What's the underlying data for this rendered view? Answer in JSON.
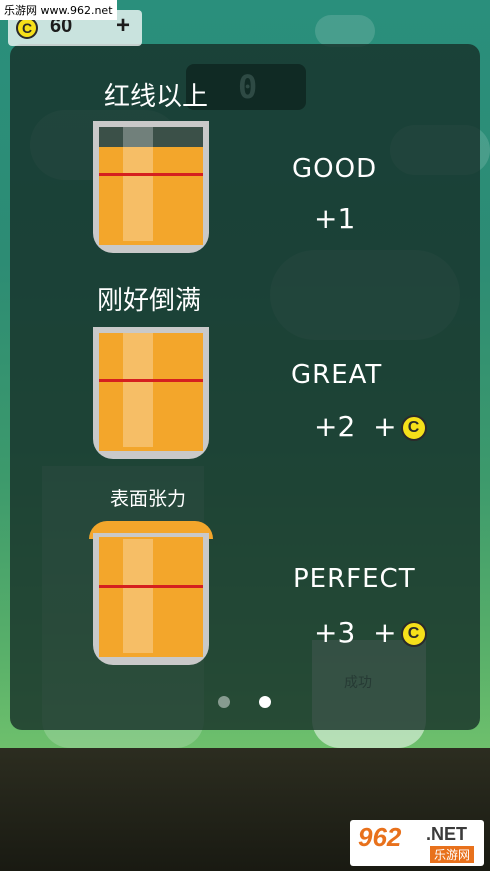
{
  "watermark": {
    "text": "乐游网 www.962.net"
  },
  "coins": {
    "count": "60",
    "add_label": "+",
    "icon": "C"
  },
  "score": {
    "value": "0"
  },
  "tutorial": {
    "items": [
      {
        "caption": "红线以上",
        "rating": "GOOD",
        "reward": "+1",
        "bonus_coin": false,
        "fill_level": 0.82
      },
      {
        "caption": "刚好倒满",
        "rating": "GREAT",
        "reward": "+2  +",
        "bonus_coin": true,
        "fill_level": 1.0
      },
      {
        "caption": "表面张力",
        "rating": "PERFECT",
        "reward": "+3  +",
        "bonus_coin": true,
        "fill_level": 1.05
      }
    ]
  },
  "pager": {
    "pages": 2,
    "active": 1
  },
  "background": {
    "success_label": "成功"
  },
  "brand": {
    "number": "962",
    "suffix": ".NET",
    "name": "乐游网"
  },
  "colors": {
    "juice": "#f3a62b",
    "red_line": "#d51f1f",
    "coin": "#f6e01a"
  }
}
